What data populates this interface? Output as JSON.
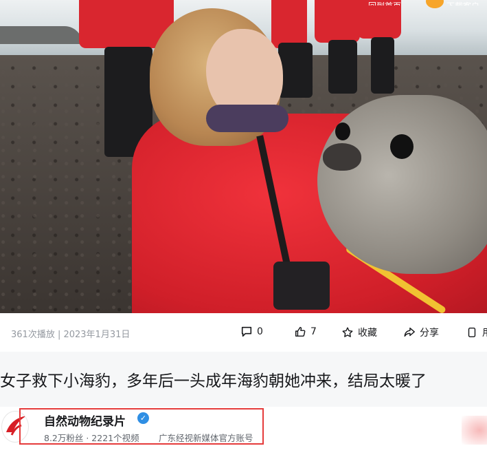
{
  "video": {
    "top_bar": {
      "left_label": "回到首页",
      "right_label": "下载客户端"
    }
  },
  "stats": {
    "meta": "361次播放 | 2023年1月31日",
    "actions": [
      {
        "icon": "comment-icon",
        "label": "0"
      },
      {
        "icon": "thumbs-up-icon",
        "label": "7"
      },
      {
        "icon": "star-icon",
        "label": "收藏"
      },
      {
        "icon": "share-icon",
        "label": "分享"
      },
      {
        "icon": "phone-icon",
        "label": "用"
      }
    ]
  },
  "title": "女子救下小海豹，多年后一头成年海豹朝她冲来，结局太暖了",
  "uploader": {
    "name": "自然动物纪录片",
    "verified_icon": "verified-check-icon",
    "stats": "8.2万粉丝 · 2221个视频",
    "description": "广东经视新媒体官方账号"
  },
  "colors": {
    "highlight_box": "#e53b3b",
    "verified": "#2f8fe4",
    "meta_text": "#9499a0",
    "title_band": "#f6f7f8"
  }
}
